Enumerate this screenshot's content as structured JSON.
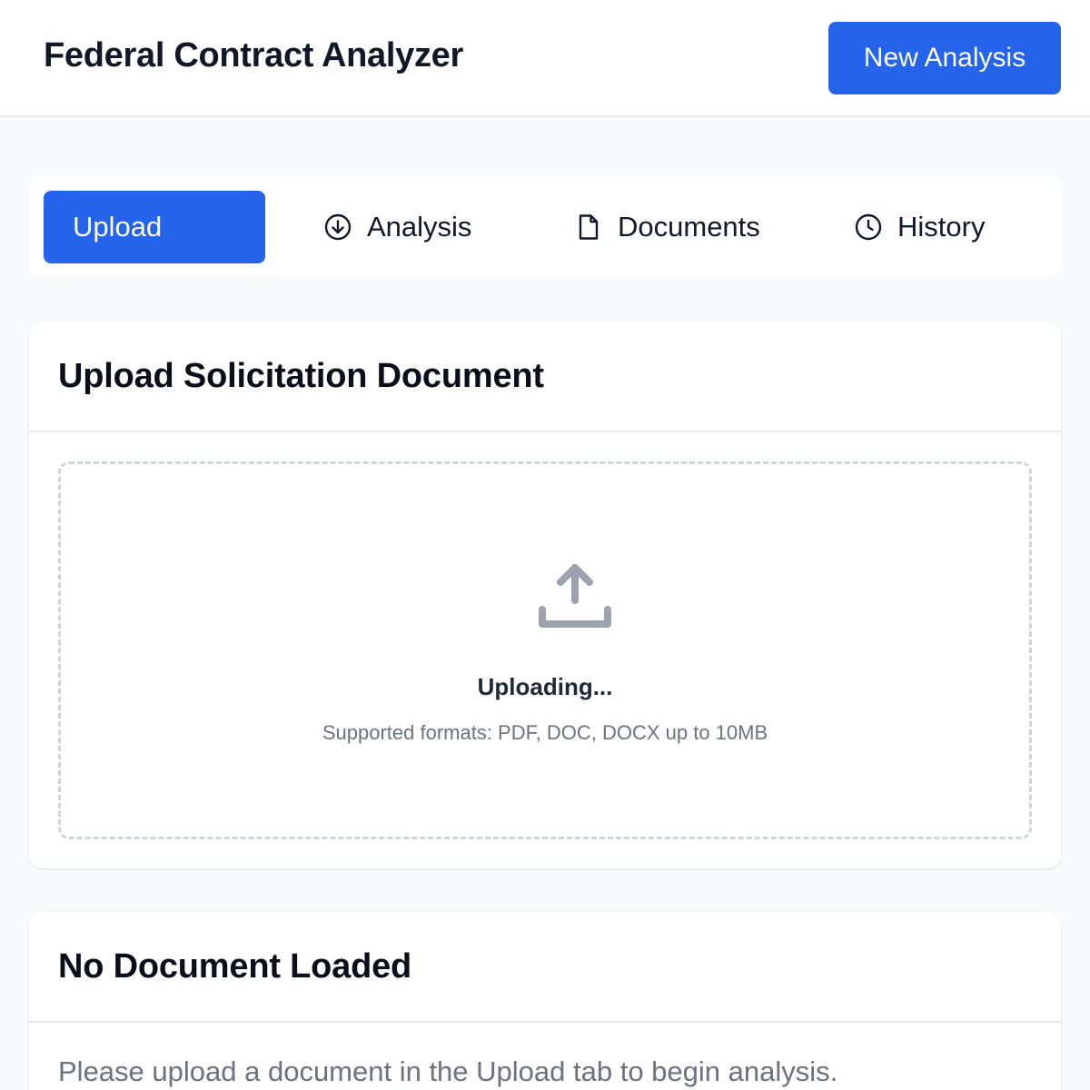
{
  "header": {
    "title": "Federal Contract Analyzer",
    "new_analysis_label": "New Analysis"
  },
  "tabs": [
    {
      "label": "Upload",
      "icon": "upload",
      "active": true
    },
    {
      "label": "Analysis",
      "icon": "arrow-down-circle-icon",
      "active": false
    },
    {
      "label": "Documents",
      "icon": "file-icon",
      "active": false
    },
    {
      "label": "History",
      "icon": "clock-icon",
      "active": false
    }
  ],
  "upload_card": {
    "title": "Upload Solicitation Document",
    "icon": "upload-icon",
    "status": "Uploading...",
    "hint": "Supported formats: PDF, DOC, DOCX up to 10MB"
  },
  "document_card": {
    "title": "No Document Loaded",
    "message": "Please upload a document in the Upload tab to begin analysis."
  },
  "colors": {
    "accent": "#2563eb",
    "background": "#f8fafc",
    "muted_text": "#6b7280",
    "dashed_border": "#d1d5db"
  }
}
